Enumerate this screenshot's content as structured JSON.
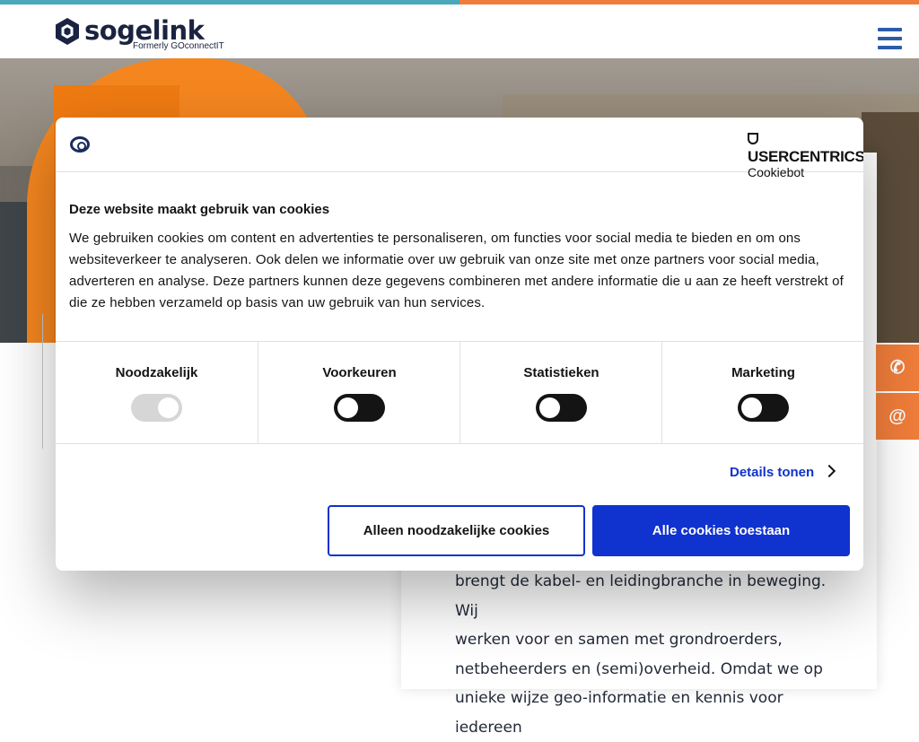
{
  "logo": {
    "wordmark": "sogelink",
    "tagline": "Formerly GOconnectIT"
  },
  "header": {
    "menu_icon": "hamburger-menu-icon"
  },
  "colors": {
    "accent_orange": "#f07d3a",
    "accent_teal": "#4aa8b8",
    "nav_blue": "#2d5ba8",
    "cookie_blue": "#1032cf"
  },
  "side_buttons": [
    {
      "icon": "phone-icon",
      "glyph": "✆"
    },
    {
      "icon": "email-icon",
      "glyph": "@"
    }
  ],
  "content": {
    "lines": [
      "brengt de kabel- en leidingbranche in beweging. Wij",
      "werken voor en samen met grondroerders,",
      "netbeheerders en (semi)overheid. Omdat we op",
      "unieke wijze geo-informatie en kennis voor iedereen"
    ]
  },
  "cookie": {
    "brand": "USERCENTRICS",
    "brand_sub": "Cookiebot",
    "title": "Deze website maakt gebruik van cookies",
    "body": "We gebruiken cookies om content en advertenties te personaliseren, om functies voor social media te bieden en om ons websiteverkeer te analyseren. Ook delen we informatie over uw gebruik van onze site met onze partners voor social media, adverteren en analyse. Deze partners kunnen deze gegevens combineren met andere informatie die u aan ze heeft verstrekt of die ze hebben verzameld op basis van uw gebruik van hun services.",
    "categories": [
      {
        "label": "Noodzakelijk",
        "state": "on",
        "disabled": true
      },
      {
        "label": "Voorkeuren",
        "state": "off",
        "disabled": false
      },
      {
        "label": "Statistieken",
        "state": "off",
        "disabled": false
      },
      {
        "label": "Marketing",
        "state": "off",
        "disabled": false
      }
    ],
    "details_label": "Details tonen",
    "necessary_only_label": "Alleen noodzakelijke cookies",
    "allow_all_label": "Alle cookies toestaan"
  }
}
